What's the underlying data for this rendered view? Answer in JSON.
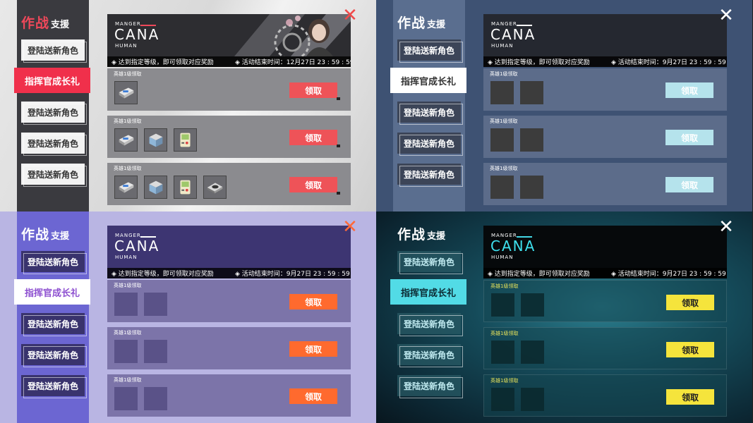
{
  "brand": {
    "title": "作战",
    "subtitle": "支援"
  },
  "nav": {
    "items": [
      "登陆送新角色",
      "指挥官成长礼",
      "登陆送新角色",
      "登陆送新角色",
      "登陆送新角色"
    ],
    "selected_index": 1
  },
  "banner": {
    "label_small": "MANGER",
    "label_big": "CANA",
    "label_sub": "HUMAN",
    "info_text": "◈ 达到指定等级，即可领取对应奖励",
    "end_time_label": "◈ 活动结束时间：",
    "end_time_q0": "12月27日 23 : 59 : 59",
    "end_time_other": "9月27日 23 : 59 : 59"
  },
  "rewards": {
    "row_label": "英雄1级领取",
    "claim_label": "领取",
    "q0_item_counts": [
      1,
      3,
      4
    ],
    "q0_item_icons": [
      [
        "console-icon"
      ],
      [
        "console-icon",
        "machine-icon",
        "gameboy-icon"
      ],
      [
        "console-icon",
        "machine-icon",
        "gameboy-icon",
        "device-icon"
      ]
    ],
    "placeholder_slots": 2
  },
  "themes": [
    {
      "name": "light-gray",
      "accent": "#f0304b",
      "claim_color": "#ee5358"
    },
    {
      "name": "navy",
      "accent": "#ffffff",
      "claim_color": "#b5e3ec"
    },
    {
      "name": "lavender",
      "accent": "#8d4fd0",
      "claim_color": "#ff6a2e"
    },
    {
      "name": "teal",
      "accent": "#52dbe6",
      "claim_color": "#f5e43c"
    }
  ],
  "close_icon": "close-icon"
}
